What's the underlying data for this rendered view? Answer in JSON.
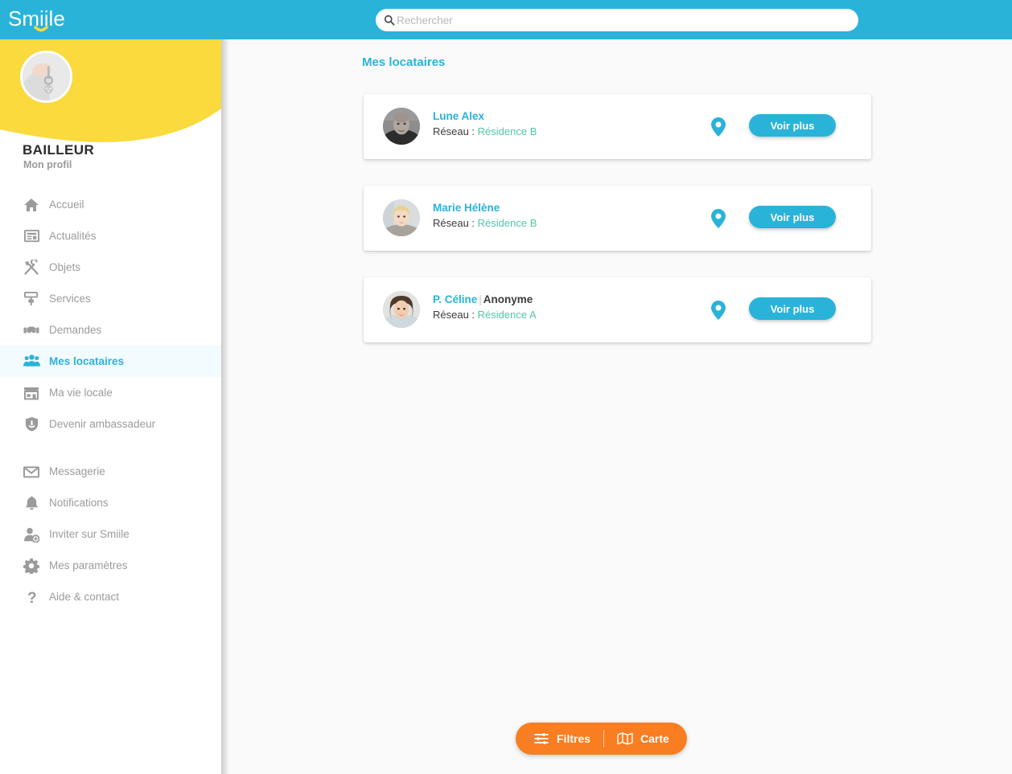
{
  "app": {
    "brand": "Smiile",
    "header_color": "#29b3d9",
    "accent_color": "#29b3d9",
    "banner_color": "#fada3c",
    "network_color": "#53c5a8",
    "fab_color": "#f97d21"
  },
  "search": {
    "placeholder": "Rechercher",
    "value": "",
    "icon": "search-icon"
  },
  "sidebar": {
    "profile": {
      "name": "BAILLEUR",
      "subtitle": "Mon profil",
      "avatar": "hand-holding-keys-photo"
    },
    "main_items": [
      {
        "label": "Accueil",
        "icon": "home-icon",
        "active": false
      },
      {
        "label": "Actualités",
        "icon": "newspaper-icon",
        "active": false
      },
      {
        "label": "Objets",
        "icon": "tools-icon",
        "active": false
      },
      {
        "label": "Services",
        "icon": "paint-roller-icon",
        "active": false
      },
      {
        "label": "Demandes",
        "icon": "handshake-icon",
        "active": false
      },
      {
        "label": "Mes locataires",
        "icon": "people-group-icon",
        "active": true
      },
      {
        "label": "Ma vie locale",
        "icon": "storefront-icon",
        "active": false
      },
      {
        "label": "Devenir ambassadeur",
        "icon": "shield-icon",
        "active": false
      }
    ],
    "secondary_items": [
      {
        "label": "Messagerie",
        "icon": "envelope-icon",
        "active": false
      },
      {
        "label": "Notifications",
        "icon": "bell-icon",
        "active": false
      },
      {
        "label": "Inviter sur Smiile",
        "icon": "user-plus-icon",
        "active": false
      },
      {
        "label": "Mes paramètres",
        "icon": "gear-icon",
        "active": false
      },
      {
        "label": "Aide & contact",
        "icon": "question-mark-icon",
        "active": false
      }
    ]
  },
  "main": {
    "page_title": "Mes locataires",
    "network_label": "Réseau :",
    "view_more_label": "Voir plus",
    "pin_icon": "map-pin-icon",
    "tenants": [
      {
        "name": "Lune Alex",
        "anonymous_tag": "",
        "network": "Résidence B",
        "avatar": "man-portrait-photo"
      },
      {
        "name": "Marie Hélène",
        "anonymous_tag": "",
        "network": "Résidence B",
        "avatar": "blonde-woman-portrait-photo"
      },
      {
        "name": "P. Céline",
        "anonymous_tag": "Anonyme",
        "network": "Résidence A",
        "avatar": "brunette-woman-portrait-photo"
      }
    ]
  },
  "action_bar": {
    "filters_label": "Filtres",
    "filters_icon": "sliders-icon",
    "map_label": "Carte",
    "map_icon": "folded-map-icon"
  }
}
